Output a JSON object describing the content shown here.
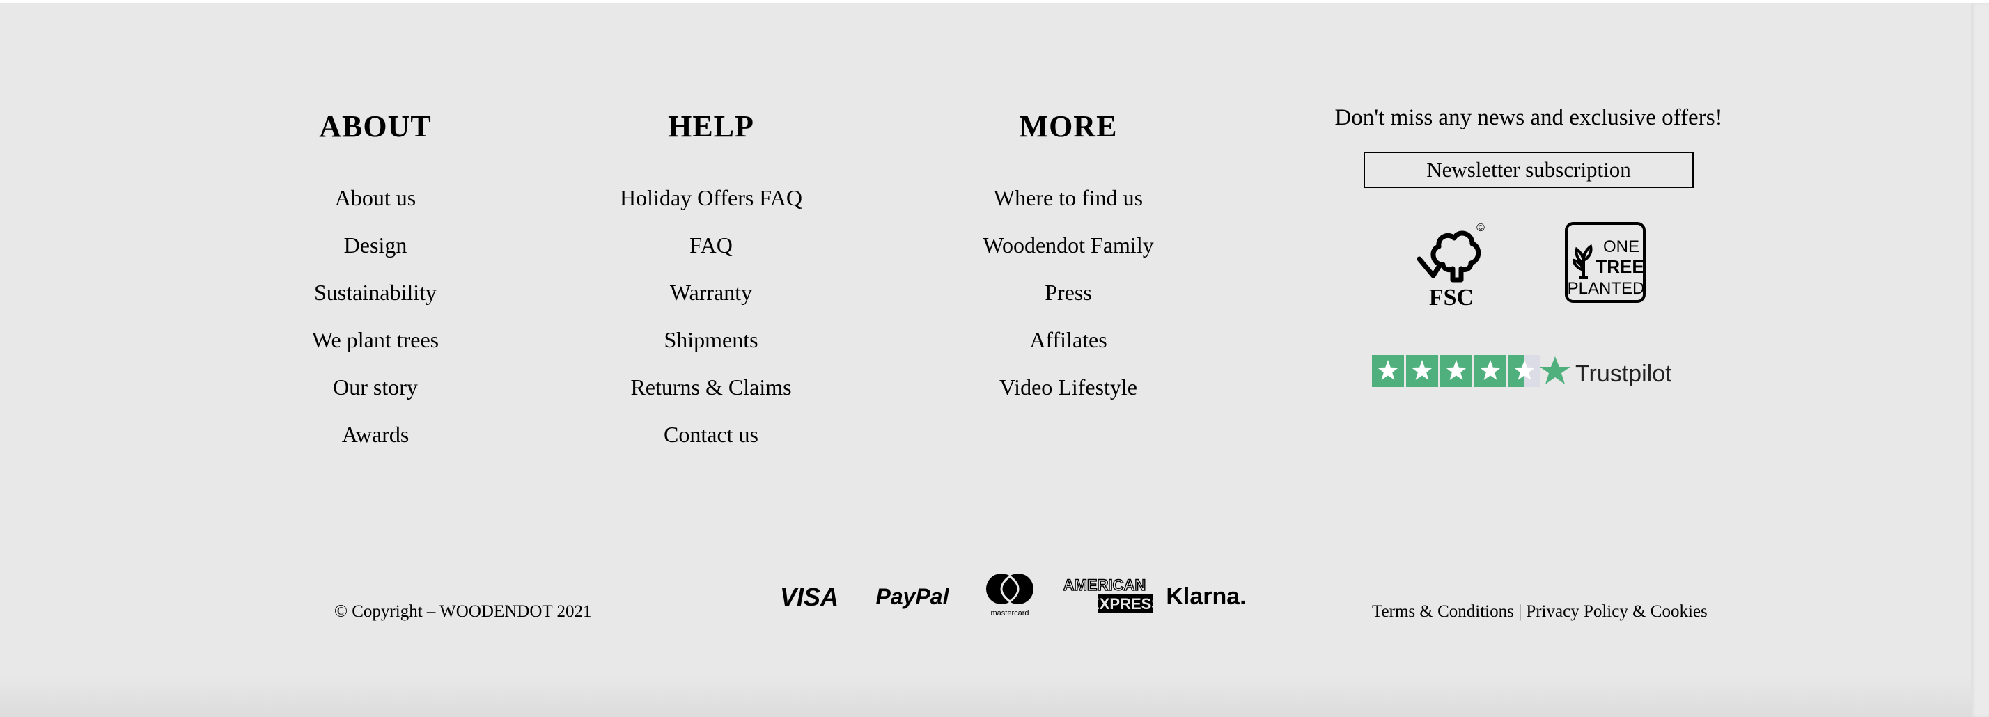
{
  "about": {
    "title": "ABOUT",
    "items": [
      "About us",
      "Design",
      "Sustainability",
      "We plant trees",
      "Our story",
      "Awards"
    ]
  },
  "help": {
    "title": "HELP",
    "items": [
      "Holiday Offers FAQ",
      "FAQ",
      "Warranty",
      "Shipments",
      "Returns & Claims",
      "Contact us"
    ]
  },
  "more": {
    "title": "MORE",
    "items": [
      "Where to find us",
      "Woodendot Family",
      "Press",
      "Affilates",
      "Video Lifestyle"
    ]
  },
  "newsletter": {
    "text": "Don't miss any news and exclusive offers!",
    "button_label": "Newsletter subscription"
  },
  "badges": {
    "fsc": {
      "icon": "fsc-tree-icon",
      "label": "FSC",
      "mark": "©"
    },
    "one_tree_planted": {
      "icon": "one-tree-planted-icon",
      "lines": [
        "ONE",
        "TREE",
        "PLANTED"
      ]
    },
    "trustpilot": {
      "label": "Trustpilot",
      "stars": 4.5,
      "color": "#4fb07e"
    }
  },
  "copyright": "© Copyright – WOODENDOT 2021",
  "payments": {
    "visa": "VISA",
    "paypal": "PayPal",
    "mastercard": "mastercard",
    "amex": [
      "AMERICAN",
      "EXPRESS"
    ],
    "klarna": "Klarna."
  },
  "legal": {
    "terms": "Terms & Conditions",
    "separator": "|",
    "privacy": "Privacy Policy & Cookies"
  },
  "colors": {
    "background": "#e8e8e8",
    "text": "#000000",
    "trustpilot_green": "#4fb07e"
  }
}
